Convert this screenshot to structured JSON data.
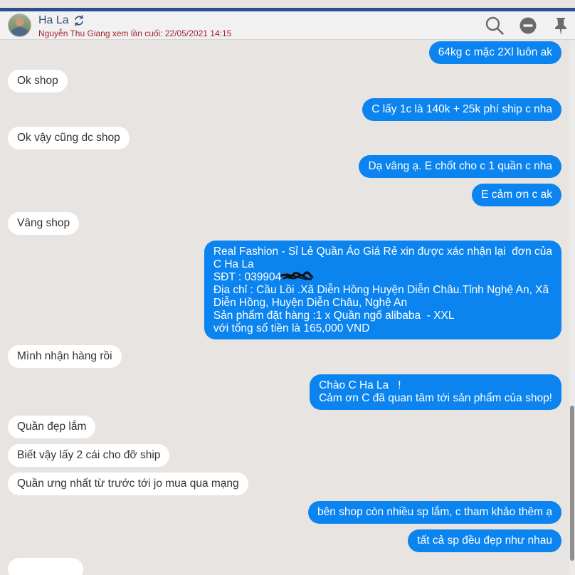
{
  "header": {
    "contact_name": "Ha La",
    "last_seen": "Nguyễn Thu Giang xem lần cuối: 22/05/2021 14:15",
    "icons": [
      "avatar",
      "refresh-icon",
      "search-icon",
      "minus-circle-icon",
      "pin-icon"
    ]
  },
  "messages": [
    {
      "side": "out",
      "text": "64kg c mặc 2Xl luôn ak"
    },
    {
      "side": "in",
      "text": "Ok shop"
    },
    {
      "side": "out",
      "text": "C lấy 1c là 140k + 25k phí ship c nha"
    },
    {
      "side": "in",
      "text": "Ok vậy cũng dc shop"
    },
    {
      "side": "out",
      "text": "Dạ vâng ạ. E chốt cho c 1 quần c nha"
    },
    {
      "side": "out",
      "text": "E cảm ơn c ak"
    },
    {
      "side": "in",
      "text": "Vâng shop"
    },
    {
      "side": "out",
      "text": "Real Fashion - Sỉ Lẻ Quần Áo Giá Rẻ xin được xác nhận lại  đơn của\nC Ha La\nSĐT : 039904\nĐịa chỉ : Cầu Lồi .Xã Diễn Hồng Huyện Diễn Châu.Tỉnh Nghệ An, Xã\nDiễn Hồng, Huyện Diễn Châu, Nghệ An\nSản phẩm đặt hàng :1 x Quần ngố alibaba  - XXL\nvới tổng số tiền là 165,000 VND"
    },
    {
      "side": "in",
      "text": "Mình nhận hàng rồi"
    },
    {
      "side": "out",
      "text": "Chào C Ha La   !\nCảm ơn C đã quan tâm tới sản phẩm của shop!"
    },
    {
      "side": "in",
      "text": "Quần đẹp lắm"
    },
    {
      "side": "in",
      "text": "Biết vậy lấy 2 cái cho đỡ ship"
    },
    {
      "side": "in",
      "text": "Quần ưng nhất từ trước tới jo mua qua mạng"
    },
    {
      "side": "out",
      "text": "bên shop còn nhiều sp lắm, c tham khảo thêm ạ"
    },
    {
      "side": "out",
      "text": "tất cả sp đều đẹp như nhau"
    },
    {
      "side": "in",
      "text": ""
    }
  ],
  "colors": {
    "incoming_bg": "#ffffff",
    "outgoing_bg": "#0b84f0",
    "background": "#e8e4e1",
    "top_bar": "#2f4d8e",
    "last_seen_text": "#a3232c"
  }
}
